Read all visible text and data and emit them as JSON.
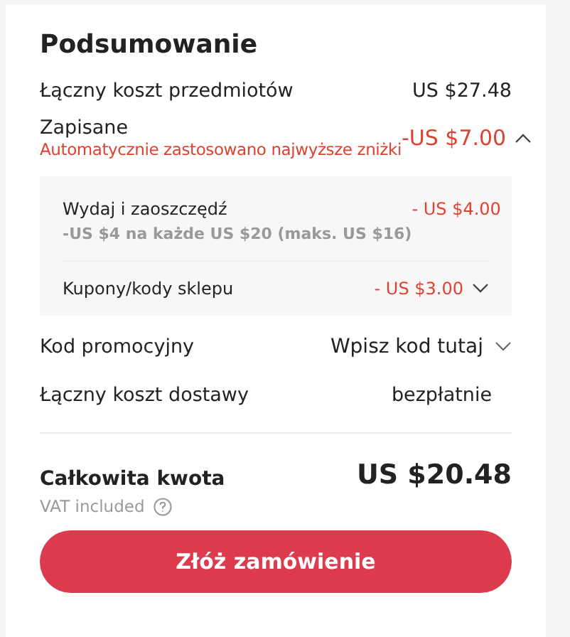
{
  "title": "Podsumowanie",
  "items_total": {
    "label": "Łączny koszt przedmiotów",
    "value": "US $27.48"
  },
  "saved": {
    "label": "Zapisane",
    "note": "Automatycznie zastosowano najwyższe zniżki",
    "value": "-US $7.00",
    "expanded": true,
    "details": [
      {
        "label": "Wydaj i zaoszczędź",
        "sub": "-US $4 na każde US $20 (maks. US $16)",
        "value": "- US $4.00",
        "kind": "plain"
      },
      {
        "label": "Kupony/kody sklepu",
        "value": "- US $3.00",
        "kind": "dropdown",
        "expanded": false
      }
    ]
  },
  "promo": {
    "label": "Kod promocyjny",
    "placeholder": "Wpisz kod tutaj",
    "expanded": false
  },
  "shipping": {
    "label": "Łączny koszt dostawy",
    "value": "bezpłatnie"
  },
  "total": {
    "label": "Całkowita kwota",
    "value": "US $20.48",
    "vat": "VAT included"
  },
  "button": "Złóż zamówienie"
}
